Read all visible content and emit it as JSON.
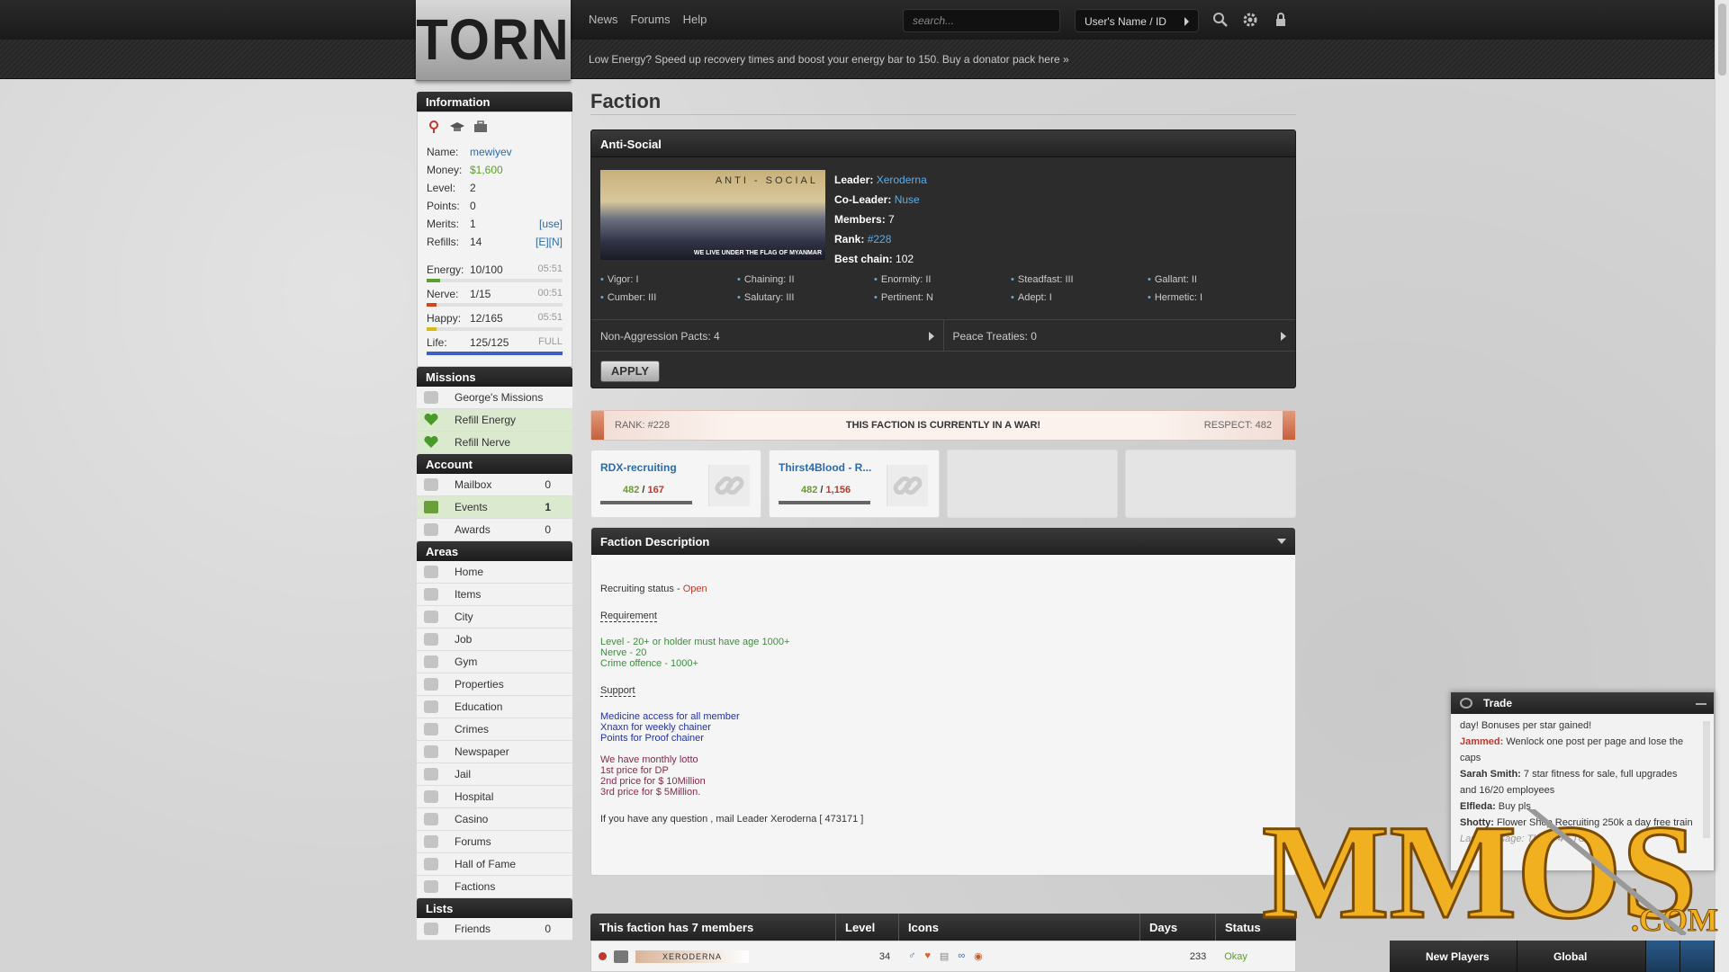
{
  "header": {
    "logo_text": "TORN",
    "nav": [
      "News",
      "Forums",
      "Help"
    ],
    "search_placeholder": "search...",
    "user_button": "User's Name / ID",
    "notice": "Low Energy? Speed up recovery times and boost your energy bar to 150. Buy a donator pack here »"
  },
  "sidebar": {
    "information_title": "Information",
    "info": [
      {
        "key": "Name:",
        "value": "mewiyev",
        "extra": ""
      },
      {
        "key": "Money:",
        "value": "$1,600",
        "extra": ""
      },
      {
        "key": "Level:",
        "value": "2",
        "extra": ""
      },
      {
        "key": "Points:",
        "value": "0",
        "extra": ""
      },
      {
        "key": "Merits:",
        "value": "1",
        "extra": "[use]"
      },
      {
        "key": "Refills:",
        "value": "14",
        "extra": "[E][N]"
      }
    ],
    "bars": [
      {
        "key": "Energy:",
        "value": "10/100",
        "time": "05:51",
        "fill": 0.1,
        "color": "#5aa02c"
      },
      {
        "key": "Nerve:",
        "value": "1/15",
        "time": "00:51",
        "fill": 0.07,
        "color": "#d0461f"
      },
      {
        "key": "Happy:",
        "value": "12/165",
        "time": "05:51",
        "fill": 0.07,
        "color": "#d4b81f"
      },
      {
        "key": "Life:",
        "value": "125/125",
        "time": "FULL",
        "fill": 1.0,
        "color": "#3b5fc4"
      }
    ],
    "missions_title": "Missions",
    "missions": [
      "George's Missions",
      "Refill Energy",
      "Refill Nerve"
    ],
    "account_title": "Account",
    "account": [
      {
        "label": "Mailbox",
        "count": "0"
      },
      {
        "label": "Events",
        "count": "1"
      },
      {
        "label": "Awards",
        "count": "0"
      }
    ],
    "areas_title": "Areas",
    "areas": [
      "Home",
      "Items",
      "City",
      "Job",
      "Gym",
      "Properties",
      "Education",
      "Crimes",
      "Newspaper",
      "Jail",
      "Hospital",
      "Casino",
      "Forums",
      "Hall of Fame",
      "Factions"
    ],
    "lists_title": "Lists",
    "lists": [
      {
        "label": "Friends",
        "count": "0"
      }
    ]
  },
  "main": {
    "page_title": "Faction",
    "faction": {
      "name": "Anti-Social",
      "banner_top": "ANTI - SOCIAL",
      "banner_bottom": "WE LIVE UNDER THE FLAG OF MYANMAR",
      "leader_label": "Leader:",
      "leader": "Xeroderna",
      "coleader_label": "Co-Leader:",
      "coleader": "Nuse",
      "members_label": "Members:",
      "members": "7",
      "rank_label": "Rank:",
      "rank": "#228",
      "chain_label": "Best chain:",
      "chain": "102",
      "perks": [
        "Vigor: I",
        "Chaining: II",
        "Enormity: II",
        "Steadfast: III",
        "Gallant: II",
        "Cumber: III",
        "Salutary: III",
        "Pertinent: N",
        "Adept: I",
        "Hermetic: I"
      ],
      "nap": "Non-Aggression Pacts: 4",
      "peace": "Peace Treaties: 0",
      "apply": "APPLY"
    },
    "war": {
      "rank": "RANK: #228",
      "status": "THIS FACTION IS CURRENTLY IN A WAR!",
      "respect": "RESPECT: 482"
    },
    "wars": [
      {
        "name": "RDX-recruiting",
        "ours": "482",
        "theirs": "167"
      },
      {
        "name": "Thirst4Blood - R...",
        "ours": "482",
        "theirs": "1,156"
      }
    ],
    "description": {
      "title": "Faction Description",
      "recruit_label": "Recruiting status - ",
      "recruit_status": "Open",
      "req_title": "Requirement",
      "req_lines": [
        "Level - 20+ or holder must have age 1000+",
        "Nerve - 20",
        "Crime offence - 1000+"
      ],
      "sup_title": "Support",
      "sup_lines": [
        "Medicine access for all member",
        "Xnaxn for weekly chainer",
        "Points for Proof chainer"
      ],
      "lotto_lines": [
        "We have monthly lotto",
        "1st price for DP",
        "2nd price for $ 10Million",
        "3rd price for $ 5Million."
      ],
      "contact": "If you have any question , mail Leader Xeroderna [ 473171 ]"
    },
    "members_table": {
      "headers": [
        "This faction has 7 members",
        "Level",
        "Icons",
        "Days",
        "Status"
      ],
      "row": {
        "name": "XERODERNA",
        "level": "34",
        "days": "233",
        "status": "Okay"
      }
    }
  },
  "trade": {
    "title": "Trade",
    "messages": [
      {
        "who": "",
        "text": "day! Bonuses per star gained!"
      },
      {
        "who": "Jammed:",
        "text": "Wenlock one post per page and lose the caps"
      },
      {
        "who": "Sarah Smith:",
        "text": "7 star fitness for sale, full upgrades and 16/20 employees"
      },
      {
        "who": "Elfleda:",
        "text": "Buy pls"
      },
      {
        "who": "Shotty:",
        "text": "Flower Shop Recruiting 250k a day free train"
      },
      {
        "who": "",
        "text": "Last message: Thu ... 4 - TCT"
      }
    ]
  },
  "chatbar": {
    "new_players": "New Players",
    "global": "Global"
  },
  "watermark": {
    "text": "MMOS",
    "suffix": ".COM"
  }
}
